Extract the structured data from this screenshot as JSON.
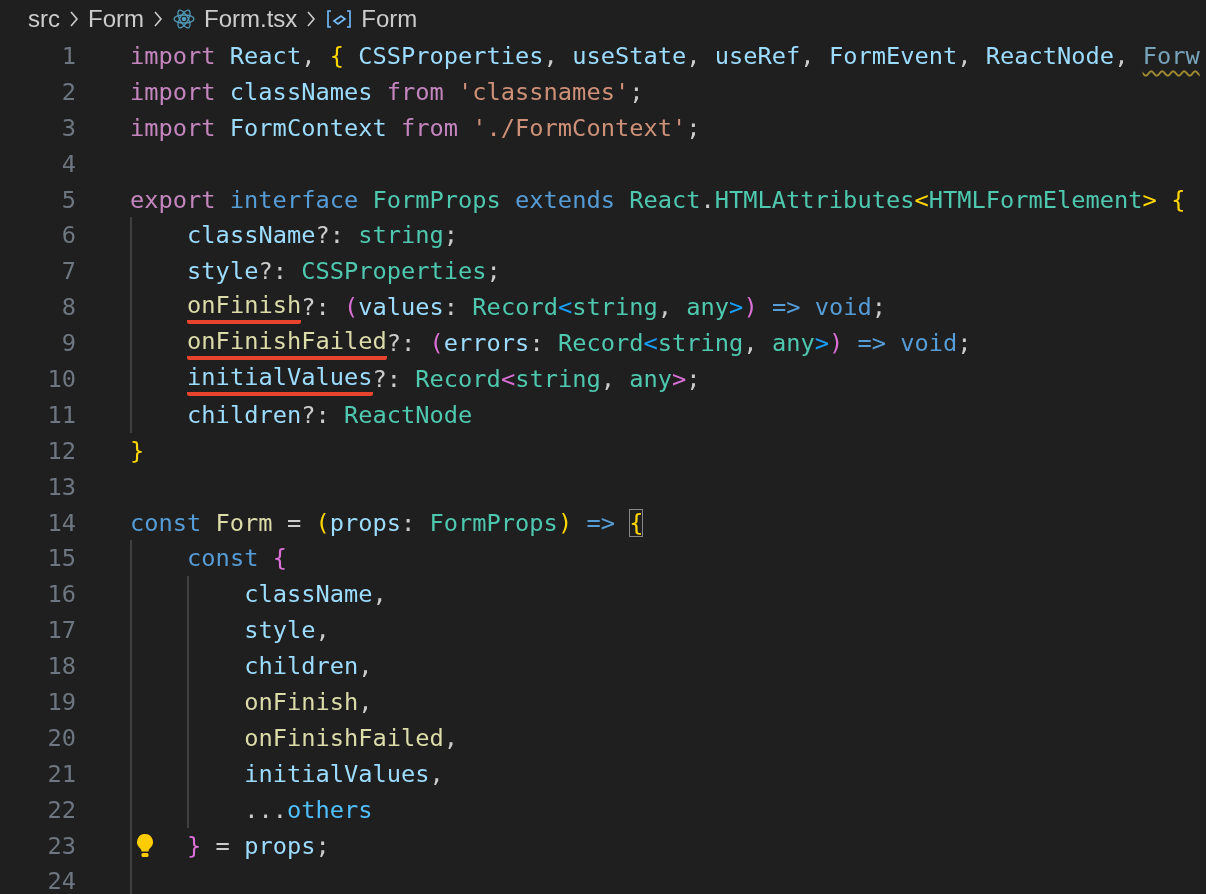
{
  "breadcrumb": [
    {
      "kind": "folder",
      "label": "src"
    },
    {
      "kind": "folder",
      "label": "Form"
    },
    {
      "kind": "react-file",
      "label": "Form.tsx"
    },
    {
      "kind": "symbol",
      "label": "Form"
    }
  ],
  "lines": [
    {
      "number": "1",
      "tokens": [
        {
          "kind": "kw",
          "text": "import"
        },
        {
          "kind": "var",
          "text": " React"
        },
        {
          "kind": "punct",
          "text": ", "
        },
        {
          "kind": "b1",
          "text": "{"
        },
        {
          "kind": "var",
          "text": " CSSProperties"
        },
        {
          "kind": "punct",
          "text": ", "
        },
        {
          "kind": "var",
          "text": "useState"
        },
        {
          "kind": "punct",
          "text": ", "
        },
        {
          "kind": "var",
          "text": "useRef"
        },
        {
          "kind": "punct",
          "text": ", "
        },
        {
          "kind": "var",
          "text": "FormEvent"
        },
        {
          "kind": "punct",
          "text": ", "
        },
        {
          "kind": "var",
          "text": "ReactNode"
        },
        {
          "kind": "punct",
          "text": ", "
        },
        {
          "kind": "var",
          "text": "Forw",
          "squiggle": true
        }
      ]
    },
    {
      "number": "2",
      "tokens": [
        {
          "kind": "kw",
          "text": "import"
        },
        {
          "kind": "var",
          "text": " classNames"
        },
        {
          "kind": "kw",
          "text": " from"
        },
        {
          "kind": "str",
          "text": " 'classnames'"
        },
        {
          "kind": "punct",
          "text": ";"
        }
      ]
    },
    {
      "number": "3",
      "tokens": [
        {
          "kind": "kw",
          "text": "import"
        },
        {
          "kind": "var",
          "text": " FormContext"
        },
        {
          "kind": "kw",
          "text": " from"
        },
        {
          "kind": "str",
          "text": " './FormContext'"
        },
        {
          "kind": "punct",
          "text": ";"
        }
      ]
    },
    {
      "number": "4"
    },
    {
      "number": "5",
      "tokens": [
        {
          "kind": "kw",
          "text": "export"
        },
        {
          "kind": "storage",
          "text": " interface"
        },
        {
          "kind": "type",
          "text": " FormProps"
        },
        {
          "kind": "storage",
          "text": " extends"
        },
        {
          "kind": "type",
          "text": " React"
        },
        {
          "kind": "punct",
          "text": "."
        },
        {
          "kind": "type",
          "text": "HTMLAttributes"
        },
        {
          "kind": "b1",
          "text": "<"
        },
        {
          "kind": "type",
          "text": "HTMLFormElement"
        },
        {
          "kind": "b1",
          "text": ">"
        },
        {
          "kind": "b1",
          "text": " {"
        }
      ]
    },
    {
      "number": "6",
      "indented": true,
      "tokens": [
        {
          "kind": "var",
          "text": "className"
        },
        {
          "kind": "punct",
          "text": "?: "
        },
        {
          "kind": "type",
          "text": "string"
        },
        {
          "kind": "punct",
          "text": ";"
        }
      ]
    },
    {
      "number": "7",
      "indented": true,
      "tokens": [
        {
          "kind": "var",
          "text": "style"
        },
        {
          "kind": "punct",
          "text": "?: "
        },
        {
          "kind": "type",
          "text": "CSSProperties"
        },
        {
          "kind": "punct",
          "text": ";"
        }
      ]
    },
    {
      "number": "8",
      "indented": true,
      "tokens": [
        {
          "kind": "fn",
          "text": "onFinish",
          "marked": true
        },
        {
          "kind": "punct",
          "text": "?: "
        },
        {
          "kind": "b2",
          "text": "("
        },
        {
          "kind": "var",
          "text": "values"
        },
        {
          "kind": "punct",
          "text": ": "
        },
        {
          "kind": "type",
          "text": "Record"
        },
        {
          "kind": "b3",
          "text": "<"
        },
        {
          "kind": "type",
          "text": "string"
        },
        {
          "kind": "punct",
          "text": ", "
        },
        {
          "kind": "type",
          "text": "any"
        },
        {
          "kind": "b3",
          "text": ">"
        },
        {
          "kind": "b2",
          "text": ")"
        },
        {
          "kind": "storage",
          "text": " =>"
        },
        {
          "kind": "storage",
          "text": " void"
        },
        {
          "kind": "punct",
          "text": ";"
        }
      ]
    },
    {
      "number": "9",
      "indented": true,
      "tokens": [
        {
          "kind": "fn",
          "text": "onFinishFailed",
          "marked": true
        },
        {
          "kind": "punct",
          "text": "?: "
        },
        {
          "kind": "b2",
          "text": "("
        },
        {
          "kind": "var",
          "text": "errors"
        },
        {
          "kind": "punct",
          "text": ": "
        },
        {
          "kind": "type",
          "text": "Record"
        },
        {
          "kind": "b3",
          "text": "<"
        },
        {
          "kind": "type",
          "text": "string"
        },
        {
          "kind": "punct",
          "text": ", "
        },
        {
          "kind": "type",
          "text": "any"
        },
        {
          "kind": "b3",
          "text": ">"
        },
        {
          "kind": "b2",
          "text": ")"
        },
        {
          "kind": "storage",
          "text": " =>"
        },
        {
          "kind": "storage",
          "text": " void"
        },
        {
          "kind": "punct",
          "text": ";"
        }
      ]
    },
    {
      "number": "10",
      "indented": true,
      "tokens": [
        {
          "kind": "var",
          "text": "initialValues",
          "marked": true
        },
        {
          "kind": "punct",
          "text": "?: "
        },
        {
          "kind": "type",
          "text": "Record"
        },
        {
          "kind": "b2",
          "text": "<"
        },
        {
          "kind": "type",
          "text": "string"
        },
        {
          "kind": "punct",
          "text": ", "
        },
        {
          "kind": "type",
          "text": "any"
        },
        {
          "kind": "b2",
          "text": ">"
        },
        {
          "kind": "punct",
          "text": ";"
        }
      ]
    },
    {
      "number": "11",
      "indented": true,
      "tokens": [
        {
          "kind": "var",
          "text": "children"
        },
        {
          "kind": "punct",
          "text": "?: "
        },
        {
          "kind": "type",
          "text": "ReactNode"
        }
      ]
    },
    {
      "number": "12",
      "tokens": [
        {
          "kind": "b1",
          "text": "}"
        }
      ]
    },
    {
      "number": "13"
    },
    {
      "number": "14",
      "tokens": [
        {
          "kind": "storage",
          "text": "const"
        },
        {
          "kind": "fn",
          "text": " Form"
        },
        {
          "kind": "punct",
          "text": " = "
        },
        {
          "kind": "b1",
          "text": "("
        },
        {
          "kind": "var",
          "text": "props"
        },
        {
          "kind": "punct",
          "text": ": "
        },
        {
          "kind": "type",
          "text": "FormProps"
        },
        {
          "kind": "b1",
          "text": ")"
        },
        {
          "kind": "storage",
          "text": " => "
        },
        {
          "kind": "b1",
          "text": "{",
          "matched": true
        }
      ]
    },
    {
      "number": "15",
      "indented": true,
      "tokens": [
        {
          "kind": "storage",
          "text": "const"
        },
        {
          "kind": "b2",
          "text": " {"
        }
      ]
    },
    {
      "number": "16",
      "indented": true,
      "nested": true,
      "tokens": [
        {
          "kind": "var",
          "text": "className"
        },
        {
          "kind": "punct",
          "text": ","
        }
      ]
    },
    {
      "number": "17",
      "indented": true,
      "nested": true,
      "tokens": [
        {
          "kind": "var",
          "text": "style"
        },
        {
          "kind": "punct",
          "text": ","
        }
      ]
    },
    {
      "number": "18",
      "indented": true,
      "nested": true,
      "tokens": [
        {
          "kind": "var",
          "text": "children"
        },
        {
          "kind": "punct",
          "text": ","
        }
      ]
    },
    {
      "number": "19",
      "indented": true,
      "nested": true,
      "tokens": [
        {
          "kind": "fn",
          "text": "onFinish"
        },
        {
          "kind": "punct",
          "text": ","
        }
      ]
    },
    {
      "number": "20",
      "indented": true,
      "nested": true,
      "tokens": [
        {
          "kind": "fn",
          "text": "onFinishFailed"
        },
        {
          "kind": "punct",
          "text": ","
        }
      ]
    },
    {
      "number": "21",
      "indented": true,
      "nested": true,
      "tokens": [
        {
          "kind": "var",
          "text": "initialValues"
        },
        {
          "kind": "punct",
          "text": ","
        }
      ]
    },
    {
      "number": "22",
      "indented": true,
      "nested": true,
      "tokens": [
        {
          "kind": "punct",
          "text": "..."
        },
        {
          "kind": "other",
          "text": "others"
        }
      ]
    },
    {
      "number": "23",
      "indented": true,
      "lightbulb": true,
      "tokens": [
        {
          "kind": "b2",
          "text": "}"
        },
        {
          "kind": "punct",
          "text": " = "
        },
        {
          "kind": "var",
          "text": "props"
        },
        {
          "kind": "punct",
          "text": ";"
        }
      ]
    },
    {
      "number": "24",
      "indented": true
    }
  ]
}
